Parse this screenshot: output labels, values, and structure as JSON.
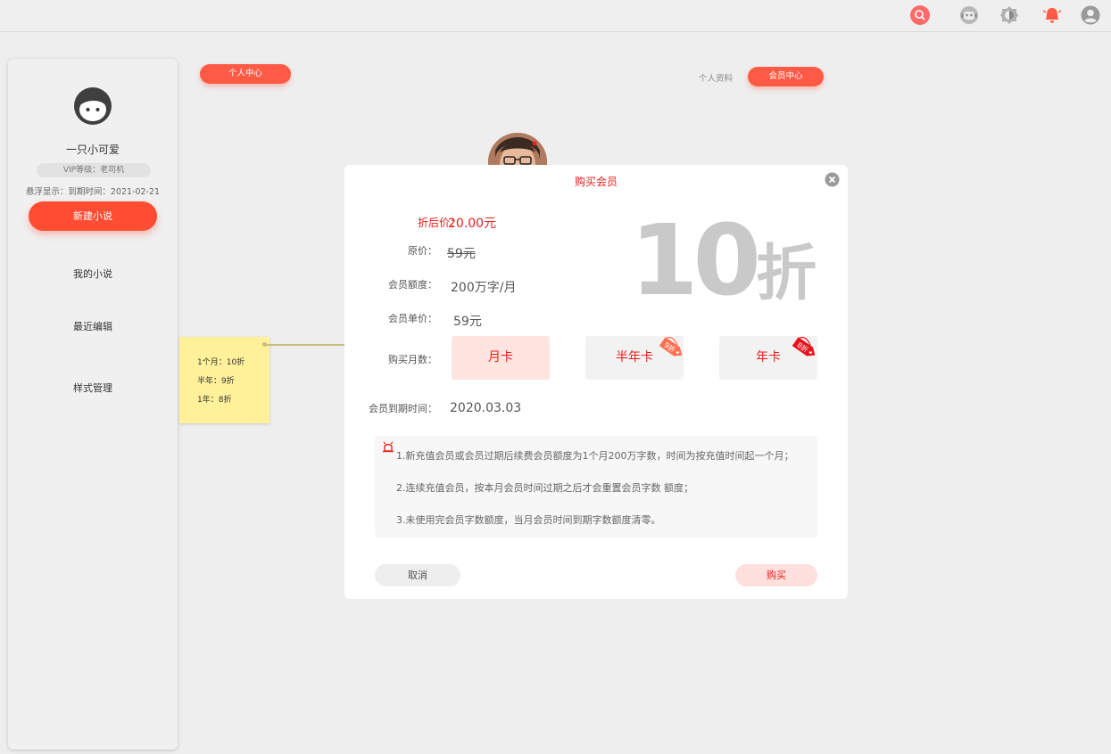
{
  "topbar": {
    "icons": [
      "search-icon",
      "robot-icon",
      "theme-toggle-icon",
      "bell-icon",
      "user-icon"
    ],
    "accent": "#ff4d4d"
  },
  "sidebar": {
    "username": "一只小可爱",
    "vip_level": "VIP等级：老司机",
    "expire_line": "悬浮显示：到期时间：2021-02-21",
    "new_novel_button": "新建小说",
    "items": [
      {
        "label": "我的小说"
      },
      {
        "label": "最近编辑"
      },
      {
        "label": "样式管理"
      }
    ]
  },
  "sticky_note": {
    "lines": [
      "1个月：10折",
      "半年：9折",
      "1年：8折"
    ]
  },
  "header": {
    "personal_center": "个人中心",
    "profile_link": "个人资料",
    "member_center": "会员中心"
  },
  "modal": {
    "title": "购买会员",
    "discount_price_label": "折后价：",
    "discount_price_value": "20.00元",
    "original_price_label": "原价：",
    "original_price_value": "59元",
    "quota_label": "会员额度：",
    "quota_value": "200万字/月",
    "unit_price_label": "会员单价：",
    "unit_price_value": "59元",
    "months_label": "购买月数：",
    "discount_big_number": "10",
    "discount_big_unit": "折",
    "plans": [
      {
        "label": "月卡",
        "selected": true
      },
      {
        "label": "半年卡",
        "tag": "9折",
        "tag_color": "#ff6f50"
      },
      {
        "label": "年卡",
        "tag": "8折",
        "tag_color": "#e8111b"
      }
    ],
    "expire_label": "会员到期时间：",
    "expire_value": "2020.03.03",
    "notices": [
      "1.新充值会员或会员过期后续费会员额度为1个月200万字数，时间为按充值时间起一个月；",
      "2.连续充值会员，按本月会员时间过期之后才会重置会员字数 额度；",
      "3.未使用完会员字数额度，当月会员时间到期字数额度清零。"
    ],
    "cancel_label": "取消",
    "buy_label": "购买",
    "colors": {
      "title": "#e8211b",
      "price": "#e8211b"
    }
  }
}
